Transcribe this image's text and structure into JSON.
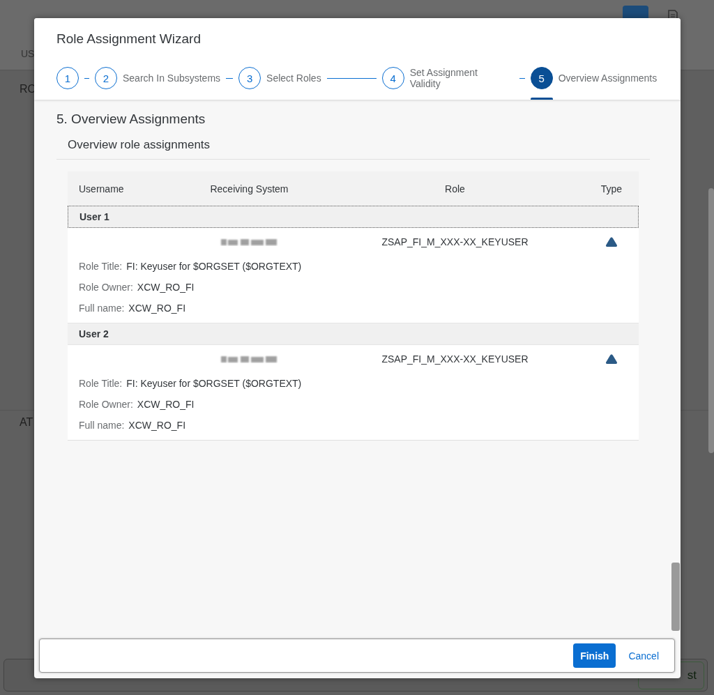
{
  "background": {
    "tab_label": "US",
    "section_1": "RO",
    "section_2": "AT",
    "footer_button": "st"
  },
  "dialog": {
    "title": "Role Assignment Wizard",
    "steps": [
      {
        "number": "1",
        "selected": false
      },
      {
        "number": "2",
        "label": "Search In Subsystems",
        "selected": false
      },
      {
        "number": "3",
        "label": "Select Roles",
        "selected": false
      },
      {
        "number": "4",
        "label": "Set Assignment Validity",
        "selected": false
      },
      {
        "number": "5",
        "label": "Overview Assignments",
        "selected": true
      }
    ],
    "section_title": "5. Overview Assignments",
    "panel_title": "Overview role assignments",
    "table": {
      "columns": [
        "Username",
        "Receiving System",
        "Role",
        "Type"
      ],
      "groups": [
        {
          "name": "User 1",
          "focused": true,
          "rows": [
            {
              "role": "ZSAP_FI_M_XXX-XX_KEYUSER",
              "details": [
                {
                  "label": "Role Title:",
                  "value": "FI: Keyuser for $ORGSET ($ORGTEXT)"
                },
                {
                  "label": "Role Owner:",
                  "value": "XCW_RO_FI"
                },
                {
                  "label": "Full name:",
                  "value": "XCW_RO_FI"
                }
              ]
            }
          ]
        },
        {
          "name": "User 2",
          "focused": false,
          "rows": [
            {
              "role": "ZSAP_FI_M_XXX-XX_KEYUSER",
              "details": [
                {
                  "label": "Role Title:",
                  "value": "FI: Keyuser for $ORGSET ($ORGTEXT)"
                },
                {
                  "label": "Role Owner:",
                  "value": "XCW_RO_FI"
                },
                {
                  "label": "Full name:",
                  "value": "XCW_RO_FI"
                }
              ]
            }
          ]
        }
      ]
    },
    "buttons": [
      {
        "label": "Finish",
        "kind": "primary"
      },
      {
        "label": "Cancel",
        "kind": "transparent"
      }
    ]
  }
}
